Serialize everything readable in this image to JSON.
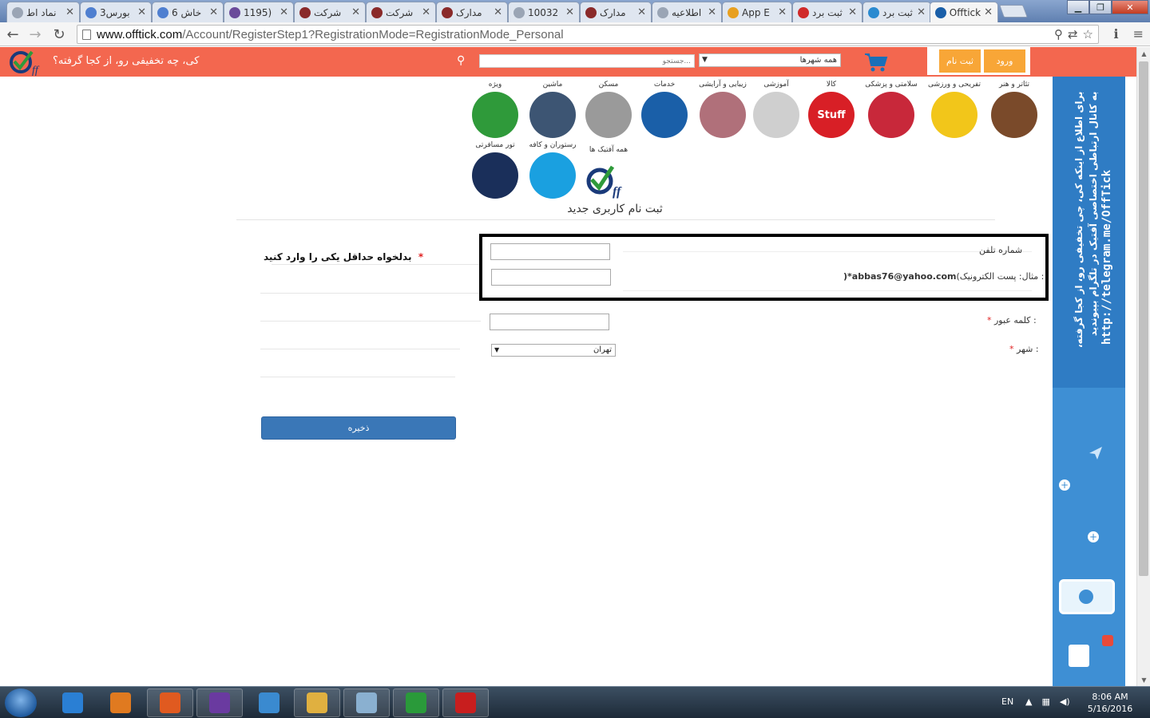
{
  "browser": {
    "tabs": [
      {
        "label": "نماد اط",
        "color": "#9aa5b5"
      },
      {
        "label": "بورس3",
        "color": "#4f7fd0"
      },
      {
        "label": "خاش 6",
        "color": "#4f7fd0"
      },
      {
        "label": "(1195",
        "color": "#6a4a9a"
      },
      {
        "label": "شرکت",
        "color": "#8a2a2a"
      },
      {
        "label": "شرکت",
        "color": "#8a2a2a"
      },
      {
        "label": "مدارک",
        "color": "#8a2a2a"
      },
      {
        "label": "10032",
        "color": "#9aa5b5"
      },
      {
        "label": "مدارک",
        "color": "#8a2a2a"
      },
      {
        "label": "اطلاعیه",
        "color": "#9aa5b5"
      },
      {
        "label": "App E",
        "color": "#e8a020"
      },
      {
        "label": "ثبت برد",
        "color": "#d02a2a"
      },
      {
        "label": "ثبت برد",
        "color": "#2a8ad0"
      },
      {
        "label": "Offtick",
        "color": "#1a5fa8"
      }
    ],
    "url_host": "www.offtick.com",
    "url_path": "/Account/RegisterStep1?RegistrationMode=RegistrationMode_Personal",
    "window_buttons": {
      "minimize": "▁",
      "maximize": "❐",
      "close": "✕"
    }
  },
  "site": {
    "logo_text": "Off",
    "tagline": "کی، چه تخفیفی رو، از کجا گرفته؟",
    "search_placeholder": "جستجو...",
    "city_selector": "همه شهرها",
    "register_button": "ثبت نام",
    "login_button": "ورود",
    "colors": {
      "header": "#f3674f",
      "accent": "#f8a637",
      "primary": "#3a77b7"
    }
  },
  "categories": [
    {
      "label": "تئاتر و هنر",
      "icon": "theater-icon",
      "color": "#7a4a2a"
    },
    {
      "label": "تفریحی و ورزشی",
      "icon": "smiley-icon",
      "color": "#f2c61a"
    },
    {
      "label": "سلامتی و پزشکی",
      "icon": "heart-icon",
      "color": "#c8283a"
    },
    {
      "label": "کالا",
      "icon": "stuff-icon",
      "color": "#d81f26",
      "text": "Stuff"
    },
    {
      "label": "آموزشی",
      "icon": "education-icon",
      "color": "#cfcfcf"
    },
    {
      "label": "زیبایی و آرایشی",
      "icon": "beauty-icon",
      "color": "#b0707a"
    },
    {
      "label": "خدمات",
      "icon": "support-icon",
      "color": "#1a5fa8"
    },
    {
      "label": "مسکن",
      "icon": "house-icon",
      "color": "#9a9a9a"
    },
    {
      "label": "ماشین",
      "icon": "car-icon",
      "color": "#3d5573"
    },
    {
      "label": "ویژه",
      "icon": "dollar-icon",
      "color": "#2f9a3a"
    },
    {
      "label": "تور مسافرتی",
      "icon": "plane-icon",
      "color": "#1a2f5a"
    },
    {
      "label": "رستوران و کافه",
      "icon": "restaurant-icon",
      "color": "#1aa0e0"
    },
    {
      "label": "همه آفتیک ها",
      "icon": "offtick-logo-icon",
      "color": "#ffffff"
    }
  ],
  "form": {
    "title": "ثبت نام کاربری جدید",
    "note": "بدلخواه حداقل یکی را وارد کنید",
    "note_required_mark": "*",
    "phone_label": "شماره تلفن",
    "email_label": "پست الکترونیک :",
    "email_example_prefix": "(مثال:",
    "email_example_value": "abbas76@yahoo.com",
    "email_example_suffix": ")*",
    "password_label": "کلمه عبور :",
    "city_label": "شهر :",
    "required_mark": "*",
    "phone_value": "",
    "email_value": "",
    "password_value": "",
    "city_value": "تهران",
    "save_button": "ذخیره"
  },
  "banner": {
    "line1": "برای اطلاع از اینکه کی، چی تخفیفی رو، از کجا گرفته،",
    "line2": "به کانال ارتباطی اختصاصی  آفتیک در تلگرام بپیوندید",
    "url": "http://telegram.me/OffTick"
  },
  "taskbar": {
    "apps": [
      {
        "name": "internet-explorer",
        "color": "#2a7fd4"
      },
      {
        "name": "media-player",
        "color": "#e07a20"
      },
      {
        "name": "firefox",
        "color": "#e05a20"
      },
      {
        "name": "visual-studio",
        "color": "#6a3aa0"
      },
      {
        "name": "browser-app",
        "color": "#3a8ad0"
      },
      {
        "name": "file-explorer",
        "color": "#e0b040"
      },
      {
        "name": "notepad-app",
        "color": "#8ab0d0"
      },
      {
        "name": "chrome",
        "color": "#2a9a3a"
      },
      {
        "name": "pdf-reader",
        "color": "#c81e1e"
      }
    ],
    "language": "EN",
    "time": "8:06 AM",
    "date": "5/16/2016"
  }
}
